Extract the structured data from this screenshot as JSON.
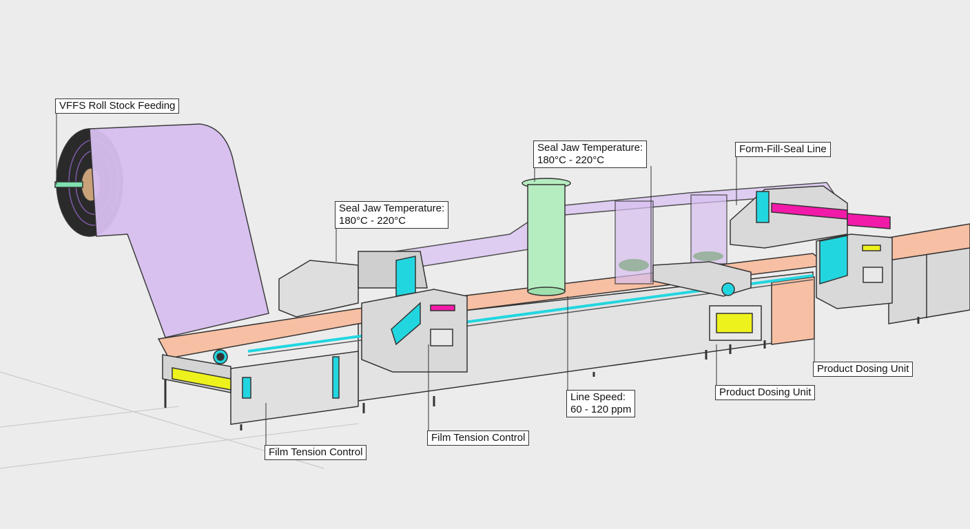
{
  "callouts": {
    "roll_feeding": "VFFS Roll Stock Feeding",
    "seal_jaw_left": {
      "line1": "Seal Jaw Temperature:",
      "line2": "180°C - 220°C"
    },
    "seal_jaw_center": {
      "line1": "Seal Jaw Temperature:",
      "line2": "180°C - 220°C"
    },
    "form_fill_seal": "Form-Fill-Seal Line",
    "dosing_right": "Product Dosing Unit",
    "dosing_center": "Product Dosing Unit",
    "line_speed": {
      "line1": "Line Speed:",
      "line2": "60 - 120 ppm"
    },
    "film_tension_center": "Film Tension Control",
    "film_tension_left": "Film Tension Control"
  },
  "colors": {
    "background": "#ececec",
    "film": "#d7bff0",
    "conveyor_belt": "#f7bfa3",
    "machine_body": "#d9d9d9",
    "accent_cyan": "#22d6e0",
    "accent_magenta": "#f21aa8",
    "accent_yellow": "#eef21c",
    "forming_tube": "#b5ecc0",
    "outline": "#333333"
  }
}
